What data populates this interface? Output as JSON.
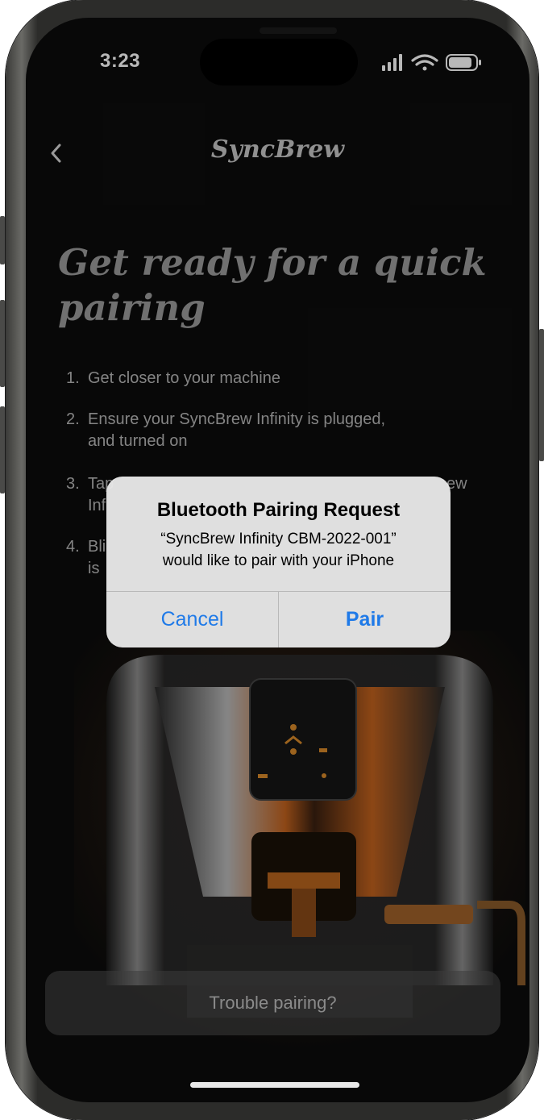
{
  "status_bar": {
    "time": "3:23",
    "signal_icon": "signal-icon",
    "wifi_icon": "wifi-icon",
    "battery_icon": "battery-icon"
  },
  "nav": {
    "title": "SyncBrew",
    "back_icon": "chevron-left-icon"
  },
  "headline": "Get ready for a quick pairing",
  "steps": [
    {
      "num": "1.",
      "lines": [
        "Get closer to your machine"
      ]
    },
    {
      "num": "2.",
      "lines": [
        "Ensure your SyncBrew Infinity is plugged,",
        "and turned on"
      ]
    },
    {
      "num": "3.",
      "lines": [
        "Tap",
        "Inf"
      ],
      "trailing": "ew"
    },
    {
      "num": "4.",
      "lines": [
        "Bli",
        "is"
      ]
    }
  ],
  "trouble_button": "Trouble pairing?",
  "alert": {
    "title": "Bluetooth Pairing Request",
    "message_line1": "“SyncBrew Infinity CBM-2022-001”",
    "message_line2": "would like to pair with your iPhone",
    "cancel": "Cancel",
    "confirm": "Pair"
  },
  "colors": {
    "accent": "#1f7ae8",
    "background": "#0c0c0c",
    "copper": "#c2621e"
  }
}
